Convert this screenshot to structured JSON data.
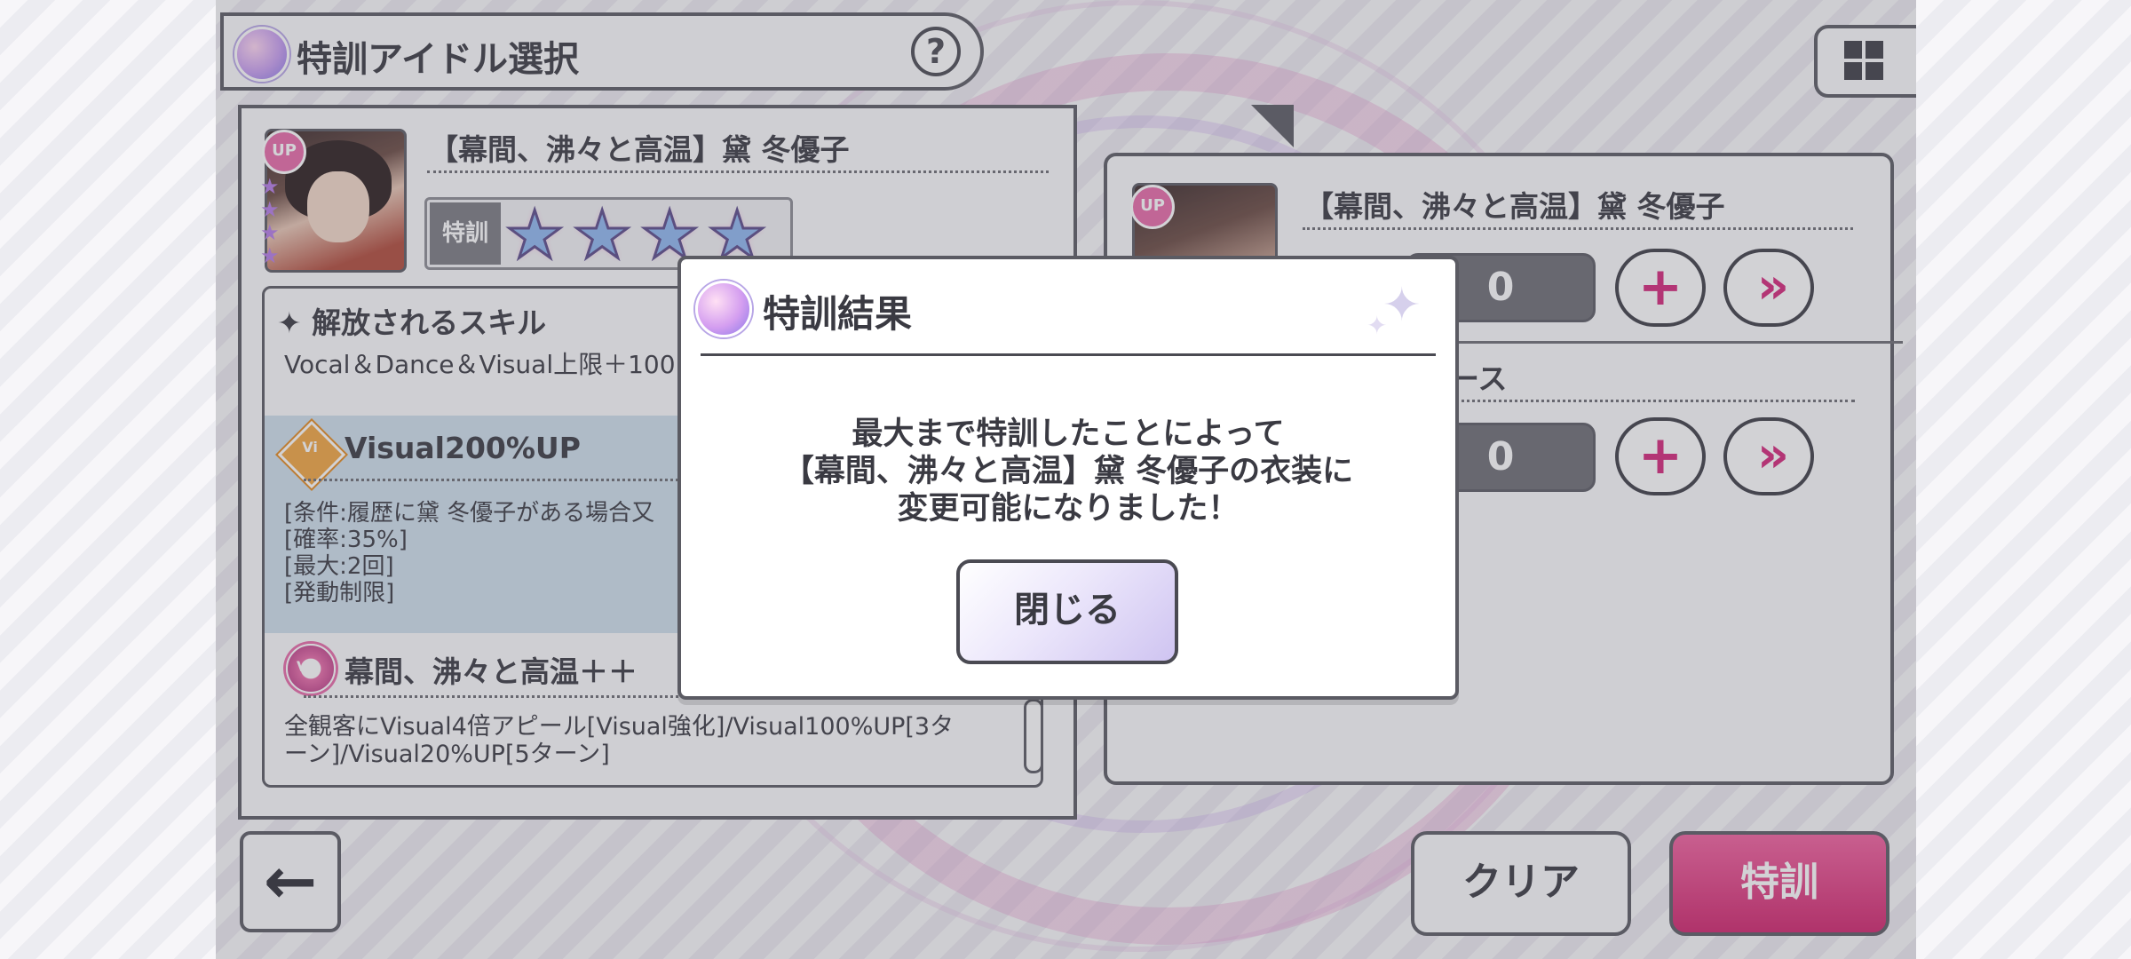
{
  "header": {
    "title": "特訓アイドル選択",
    "help_label": "?"
  },
  "idol": {
    "name": "【幕間、沸々と高温】黛 冬優子",
    "up_badge": "UP",
    "rarity_stars": 4,
    "tokkun_label": "特訓",
    "tokkun_stars": 4
  },
  "skills": {
    "header": "✦ 解放されるスキル",
    "truncated_line": "Vocal＆Dance＆Visual上限＋100",
    "skill1": {
      "icon": "Vi",
      "name": "Visual200%UP",
      "conditions": [
        "[条件:履歴に黛 冬優子がある場合又",
        "[確率:35%]",
        "[最大:2回]",
        "[発動制限]"
      ]
    },
    "skill2": {
      "icon": "Vi",
      "name": "幕間、沸々と高温＋＋",
      "description": "全観客にVisual4倍アピール[Visual強化]/Visual100%UP[3ターン]/Visual20%UP[5ターン]"
    }
  },
  "right_panel": {
    "idol_name": "【幕間、沸々と高温】黛 冬優子",
    "counter1_value": "0",
    "counter2_value": "0",
    "partial_label": "ース",
    "plus_label": "+",
    "max_label": "»"
  },
  "bottom": {
    "back_label": "←",
    "clear_label": "クリア",
    "tokkun_label": "特訓"
  },
  "modal": {
    "title": "特訓結果",
    "message_lines": [
      "最大まで特訓したことによって",
      "【幕間、沸々と高温】黛 冬優子の衣装に",
      "変更可能になりました！"
    ],
    "close_label": "閉じる"
  },
  "colors": {
    "accent_pink": "#d4267a",
    "border_dark": "#5b5b63",
    "highlight_blue": "#cfe0ec",
    "star_blue": "#8fb7f0"
  }
}
